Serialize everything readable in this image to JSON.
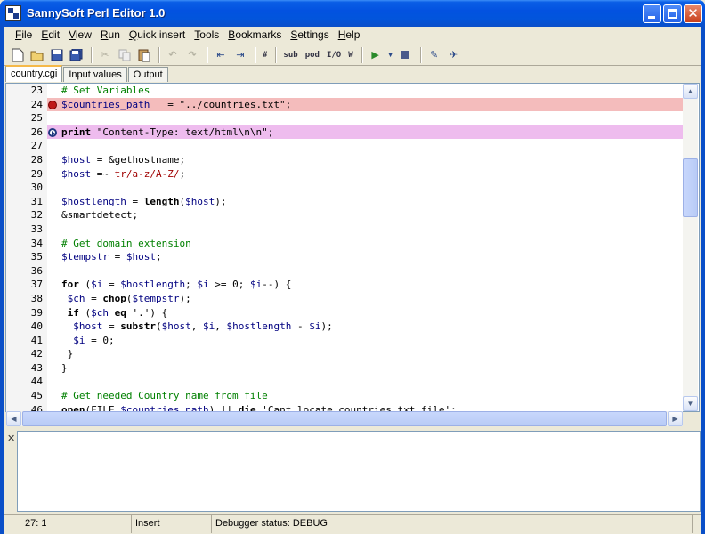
{
  "window": {
    "title": "SannySoft Perl Editor 1.0"
  },
  "menu": [
    {
      "label": "File",
      "key": "F",
      "rest": "ile"
    },
    {
      "label": "Edit",
      "key": "E",
      "rest": "dit"
    },
    {
      "label": "View",
      "key": "V",
      "rest": "iew"
    },
    {
      "label": "Run",
      "key": "R",
      "rest": "un"
    },
    {
      "label": "Quick insert",
      "key": "Q",
      "rest": "uick insert"
    },
    {
      "label": "Tools",
      "key": "T",
      "rest": "ools"
    },
    {
      "label": "Bookmarks",
      "key": "B",
      "rest": "ookmarks"
    },
    {
      "label": "Settings",
      "key": "S",
      "rest": "ettings"
    },
    {
      "label": "Help",
      "key": "H",
      "rest": "elp"
    }
  ],
  "toolbar": {
    "sub_label": "sub",
    "pod_label": "pod",
    "io_label": "I/O",
    "w_label": "W",
    "hash_label": "#"
  },
  "tabs": [
    {
      "label": "country.cgi",
      "active": true
    },
    {
      "label": "Input values",
      "active": false
    },
    {
      "label": "Output",
      "active": false
    }
  ],
  "editor": {
    "lines": [
      {
        "num": "23",
        "html": "<span class='c-comment'># Set Variables</span>"
      },
      {
        "num": "24",
        "marker": "breakpoint",
        "html": "<span class='c-var'>$countries_path</span>   = \"../countries.txt\";"
      },
      {
        "num": "25",
        "html": ""
      },
      {
        "num": "26",
        "marker": "exec",
        "html": "<span class='c-kw'>print</span> \"Content-Type: text/html\\n\\n\";"
      },
      {
        "num": "27",
        "html": ""
      },
      {
        "num": "28",
        "html": "<span class='c-var'>$host</span> = &amp;gethostname;"
      },
      {
        "num": "29",
        "html": "<span class='c-var'>$host</span> =~ <span class='c-re'>tr/a-z/A-Z/</span>;"
      },
      {
        "num": "30",
        "html": ""
      },
      {
        "num": "31",
        "html": "<span class='c-var'>$hostlength</span> = <span class='c-kw'>length</span>(<span class='c-var'>$host</span>);"
      },
      {
        "num": "32",
        "html": "&amp;smartdetect;"
      },
      {
        "num": "33",
        "html": ""
      },
      {
        "num": "34",
        "html": "<span class='c-comment'># Get domain extension</span>"
      },
      {
        "num": "35",
        "html": "<span class='c-var'>$tempstr</span> = <span class='c-var'>$host</span>;"
      },
      {
        "num": "36",
        "html": ""
      },
      {
        "num": "37",
        "html": "<span class='c-kw'>for</span> (<span class='c-var'>$i</span> = <span class='c-var'>$hostlength</span>; <span class='c-var'>$i</span> &gt;= 0; <span class='c-var'>$i</span>--) {"
      },
      {
        "num": "38",
        "html": " <span class='c-var'>$ch</span> = <span class='c-kw'>chop</span>(<span class='c-var'>$tempstr</span>);"
      },
      {
        "num": "39",
        "html": " <span class='c-kw'>if</span> (<span class='c-var'>$ch</span> <span class='c-kw'>eq</span> '.') {"
      },
      {
        "num": "40",
        "html": "  <span class='c-var'>$host</span> = <span class='c-kw'>substr</span>(<span class='c-var'>$host</span>, <span class='c-var'>$i</span>, <span class='c-var'>$hostlength</span> - <span class='c-var'>$i</span>);"
      },
      {
        "num": "41",
        "html": "  <span class='c-var'>$i</span> = 0;"
      },
      {
        "num": "42",
        "html": " }"
      },
      {
        "num": "43",
        "html": "}"
      },
      {
        "num": "44",
        "html": ""
      },
      {
        "num": "45",
        "html": "<span class='c-comment'># Get needed Country name from file</span>"
      },
      {
        "num": "46",
        "html": "<span class='c-kw'>open</span>(FILE,<span class='c-var'>$countries_path</span>) || <span class='c-kw'>die</span> 'Cant locate countries.txt file';"
      }
    ]
  },
  "status": {
    "position": "27: 1",
    "mode": "Insert",
    "debugger": "Debugger status: DEBUG"
  }
}
